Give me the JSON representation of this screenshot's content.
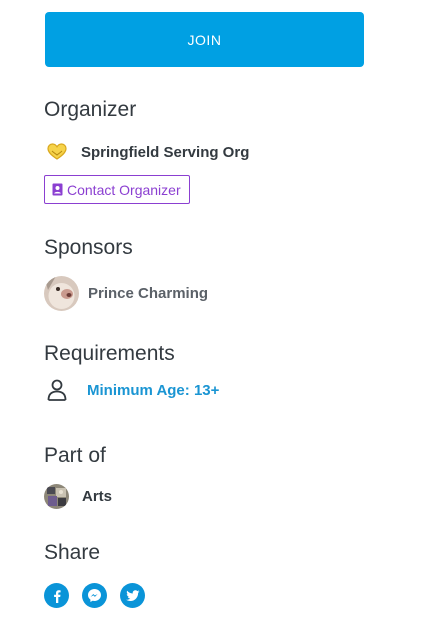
{
  "join": {
    "label": "JOIN"
  },
  "organizer": {
    "heading": "Organizer",
    "name": "Springfield Serving Org",
    "logo_icon": "heart-hands-icon",
    "contact_label": "Contact Organizer"
  },
  "sponsors": {
    "heading": "Sponsors",
    "items": [
      {
        "name": "Prince Charming",
        "avatar": "dog-avatar"
      }
    ]
  },
  "requirements": {
    "heading": "Requirements",
    "items": [
      {
        "icon": "person-icon",
        "text": "Minimum Age: 13+"
      }
    ]
  },
  "part_of": {
    "heading": "Part of",
    "items": [
      {
        "name": "Arts",
        "avatar": "arts-avatar"
      }
    ]
  },
  "share": {
    "heading": "Share",
    "icons": [
      "facebook-icon",
      "messenger-icon",
      "twitter-icon"
    ]
  },
  "colors": {
    "primary": "#00a0e3",
    "accent": "#8b3fd1",
    "link": "#1a95d3",
    "text": "#333a40"
  }
}
